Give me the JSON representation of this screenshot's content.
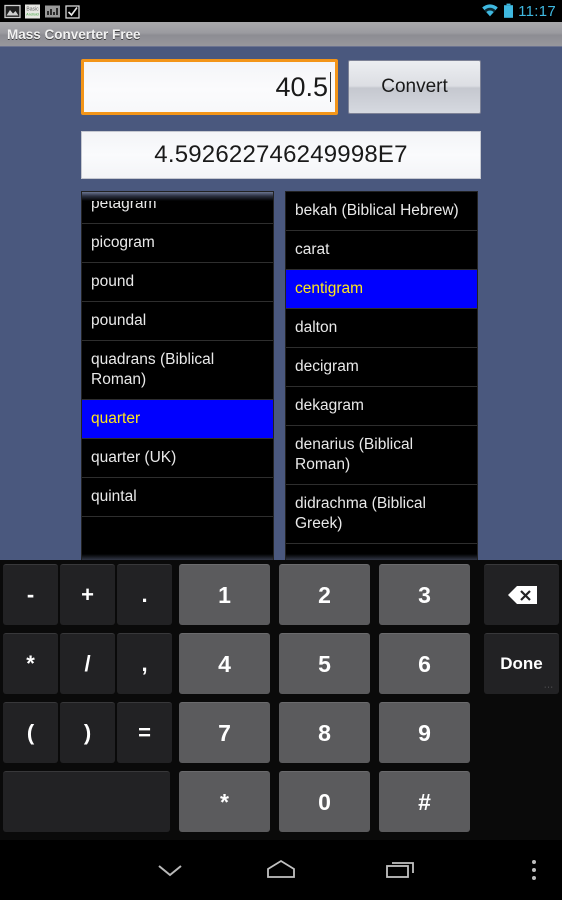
{
  "status_bar": {
    "time": "11:17",
    "time_color": "#3FB8E0",
    "notification_icons": [
      "gallery-image-icon",
      "basic-android-app-icon",
      "photo-app-icon",
      "checkmark-clipboard-icon"
    ],
    "system_icons": [
      "wifi-icon",
      "battery-icon"
    ]
  },
  "title_bar": {
    "title": "Mass Converter Free"
  },
  "converter": {
    "amount_value": "40.5",
    "amount_placeholder": "",
    "convert_label": "Convert",
    "result_value": "4.592622746249998E7",
    "focus_color": "#F39519"
  },
  "unit_lists": {
    "selection_bg": "#0000FF",
    "selection_fg": "#FFE81A",
    "from": {
      "selected": "quarter",
      "items": [
        {
          "label": "petagram",
          "selected": false
        },
        {
          "label": "picogram",
          "selected": false
        },
        {
          "label": "pound",
          "selected": false
        },
        {
          "label": "poundal",
          "selected": false
        },
        {
          "label": "quadrans (Biblical Roman)",
          "selected": false
        },
        {
          "label": "quarter",
          "selected": true
        },
        {
          "label": "quarter (UK)",
          "selected": false
        },
        {
          "label": "quintal",
          "selected": false
        }
      ]
    },
    "to": {
      "selected": "centigram",
      "items": [
        {
          "label": "bekah (Biblical Hebrew)",
          "selected": false
        },
        {
          "label": "carat",
          "selected": false
        },
        {
          "label": "centigram",
          "selected": true
        },
        {
          "label": "dalton",
          "selected": false
        },
        {
          "label": "decigram",
          "selected": false
        },
        {
          "label": "dekagram",
          "selected": false
        },
        {
          "label": "denarius (Biblical Roman)",
          "selected": false
        },
        {
          "label": "didrachma (Biblical Greek)",
          "selected": false
        }
      ]
    }
  },
  "keyboard": {
    "rows": [
      [
        {
          "label": "-",
          "style": "dark"
        },
        {
          "label": "+",
          "style": "dark"
        },
        {
          "label": ".",
          "style": "dark"
        },
        {
          "label": "1",
          "style": "light"
        },
        {
          "label": "2",
          "style": "light"
        },
        {
          "label": "3",
          "style": "light"
        },
        {
          "label": "",
          "style": "dark",
          "icon": "backspace-icon"
        }
      ],
      [
        {
          "label": "*",
          "style": "dark"
        },
        {
          "label": "/",
          "style": "dark"
        },
        {
          "label": ",",
          "style": "dark"
        },
        {
          "label": "4",
          "style": "light"
        },
        {
          "label": "5",
          "style": "light"
        },
        {
          "label": "6",
          "style": "light"
        },
        {
          "label": "Done",
          "style": "dark"
        }
      ],
      [
        {
          "label": "(",
          "style": "dark"
        },
        {
          "label": ")",
          "style": "dark"
        },
        {
          "label": "=",
          "style": "dark"
        },
        {
          "label": "7",
          "style": "light"
        },
        {
          "label": "8",
          "style": "light"
        },
        {
          "label": "9",
          "style": "light"
        }
      ],
      [
        {
          "label": "",
          "style": "blank"
        },
        {
          "label": "*",
          "style": "light"
        },
        {
          "label": "0",
          "style": "light"
        },
        {
          "label": "#",
          "style": "light"
        }
      ]
    ]
  },
  "nav_bar": {
    "items": [
      "hide-keyboard-icon",
      "home-icon",
      "recents-icon",
      "overflow-menu-icon"
    ]
  }
}
